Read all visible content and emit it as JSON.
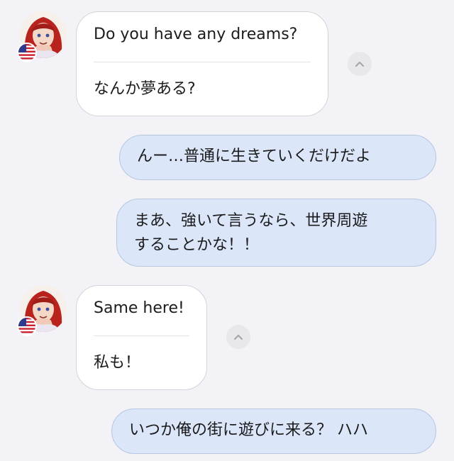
{
  "conversation": {
    "messages": [
      {
        "id": "m1",
        "direction": "incoming",
        "flag": "us-flag",
        "original": "Do you have any dreams?",
        "translation": "なんか夢ある?"
      },
      {
        "id": "m2",
        "direction": "outgoing",
        "text": "んー…普通に生きていくだけだよ"
      },
      {
        "id": "m3",
        "direction": "outgoing",
        "text": "まあ、強いて言うなら、世界周遊\nすることかな！！"
      },
      {
        "id": "m4",
        "direction": "incoming",
        "flag": "us-flag",
        "original": "Same here!",
        "translation": "私も！"
      },
      {
        "id": "m5",
        "direction": "outgoing",
        "text": "いつか俺の街に遊びに来る？ ハハ"
      }
    ]
  },
  "colors": {
    "background": "#f2f2f7",
    "incoming_bubble": "#ffffff",
    "outgoing_bubble": "#dbe6f8",
    "avatar_hair": "#b8231d"
  },
  "icons": {
    "collapse": "chevron-up-icon",
    "country": "us-flag-icon"
  }
}
